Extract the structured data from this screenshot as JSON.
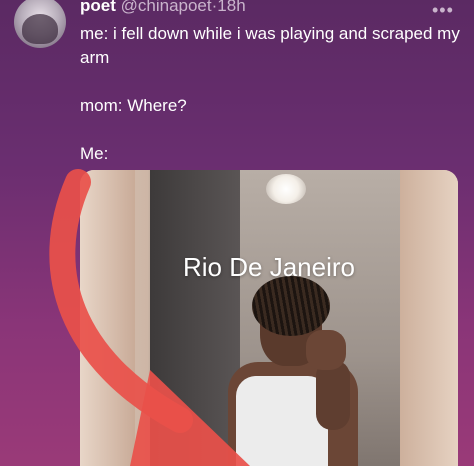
{
  "tweet": {
    "display_name": "poet",
    "handle": "@chinapoet",
    "separator": "·",
    "time": "18h",
    "more_icon": "ellipsis-icon",
    "lines": [
      "me: i fell down while i was playing and scraped my arm",
      "mom: Where?",
      "Me:"
    ]
  },
  "media": {
    "overlay_text": "Rio De Janeiro"
  },
  "colors": {
    "background_top": "#5b2a63",
    "background_bottom": "#9a3a78",
    "arrow": "#e9504a",
    "secondary_text": "#c9b4cc"
  }
}
